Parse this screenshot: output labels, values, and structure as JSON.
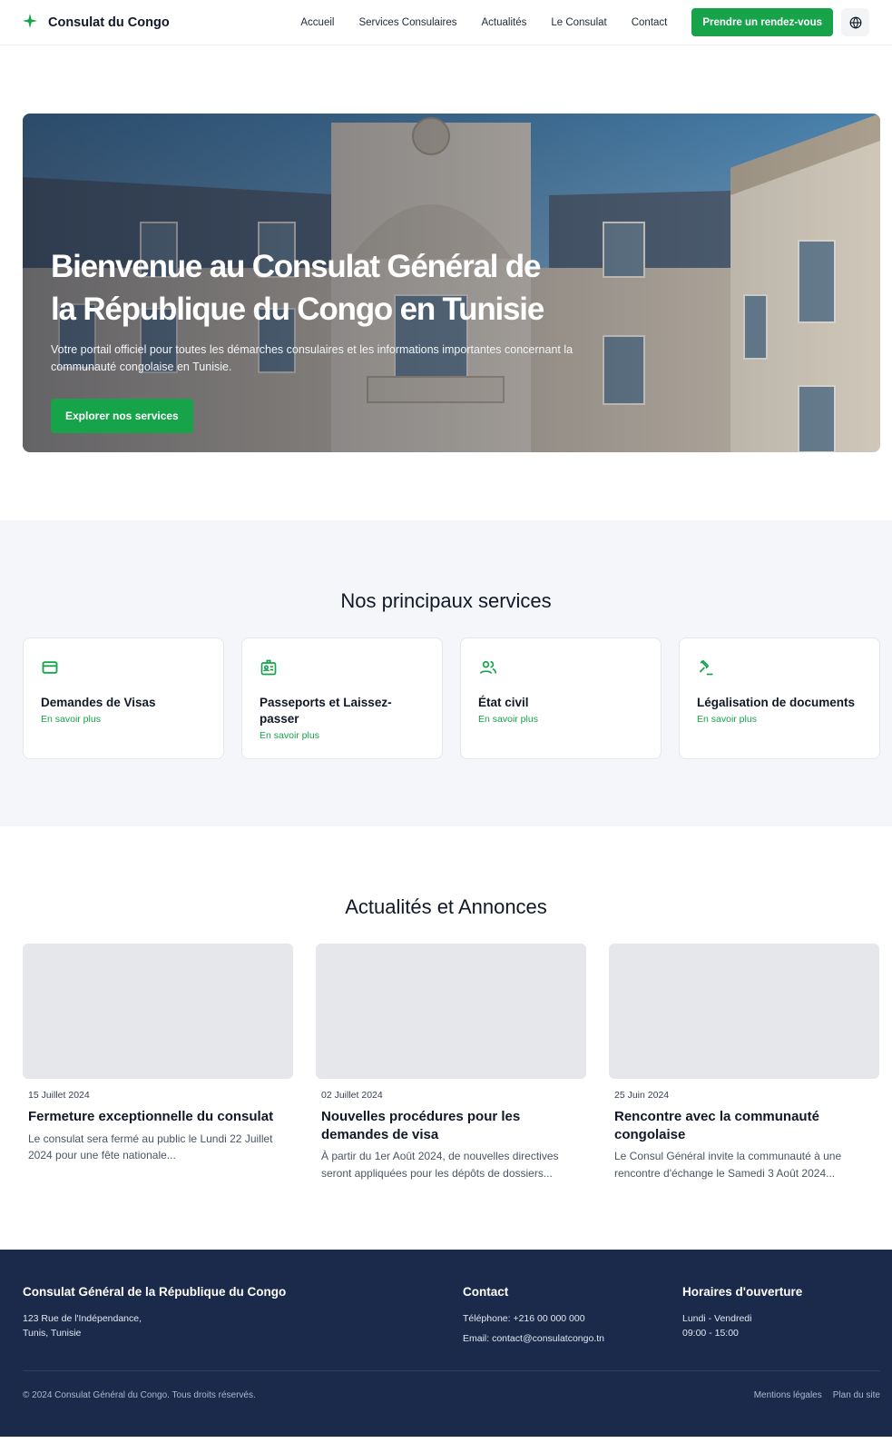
{
  "header": {
    "brand_name": "Consulat du Congo",
    "nav": [
      {
        "label": "Accueil"
      },
      {
        "label": "Services Consulaires"
      },
      {
        "label": "Actualités"
      },
      {
        "label": "Le Consulat"
      },
      {
        "label": "Contact"
      }
    ],
    "cta_label": "Prendre un rendez-vous",
    "brand_icon": "star-icon",
    "language_icon": "globe-icon"
  },
  "hero": {
    "title_line1": "Bienvenue au Consulat Général de",
    "title_line2": "la République du Congo en Tunisie",
    "subtitle": "Votre portail officiel pour toutes les démarches consulaires et les informations importantes concernant la communauté congolaise en Tunisie.",
    "button_label": "Explorer nos services"
  },
  "services": {
    "title": "Nos principaux services",
    "items": [
      {
        "title": "Demandes de Visas",
        "link": "En savoir plus",
        "icon": "credit-card-icon"
      },
      {
        "title": "Passeports et Laissez-passer",
        "link": "En savoir plus",
        "icon": "id-badge-icon"
      },
      {
        "title": "État civil",
        "link": "En savoir plus",
        "icon": "users-icon"
      },
      {
        "title": "Légalisation de documents",
        "link": "En savoir plus",
        "icon": "gavel-icon"
      }
    ]
  },
  "news": {
    "title": "Actualités et Annonces",
    "items": [
      {
        "date": "15 Juillet 2024",
        "title": "Fermeture exceptionnelle du consulat",
        "excerpt": "Le consulat sera fermé au public le Lundi 22 Juillet 2024 pour une fête nationale..."
      },
      {
        "date": "02 Juillet 2024",
        "title": "Nouvelles procédures pour les demandes de visa",
        "excerpt": "À partir du 1er Août 2024, de nouvelles directives seront appliquées pour les dépôts de dossiers..."
      },
      {
        "date": "25 Juin 2024",
        "title": "Rencontre avec la communauté congolaise",
        "excerpt": "Le Consul Général invite la communauté à une rencontre d'échange le Samedi 3 Août 2024..."
      }
    ]
  },
  "footer": {
    "org_title": "Consulat Général de la République du Congo",
    "address_line1": "123 Rue de l'Indépendance,",
    "address_line2": "Tunis, Tunisie",
    "contact_title": "Contact",
    "phone": "Téléphone: +216 00 000 000",
    "email": "Email: contact@consulatcongo.tn",
    "hours_title": "Horaires d'ouverture",
    "hours_days": "Lundi - Vendredi",
    "hours_time": "09:00 - 15:00",
    "copyright": "© 2024 Consulat Général du Congo. Tous droits réservés.",
    "links": [
      {
        "label": "Mentions légales"
      },
      {
        "label": "Plan du site"
      }
    ]
  },
  "colors": {
    "accent": "#16a34a",
    "footer_bg": "#1b2a4a",
    "section_bg": "#f4f6fa"
  }
}
